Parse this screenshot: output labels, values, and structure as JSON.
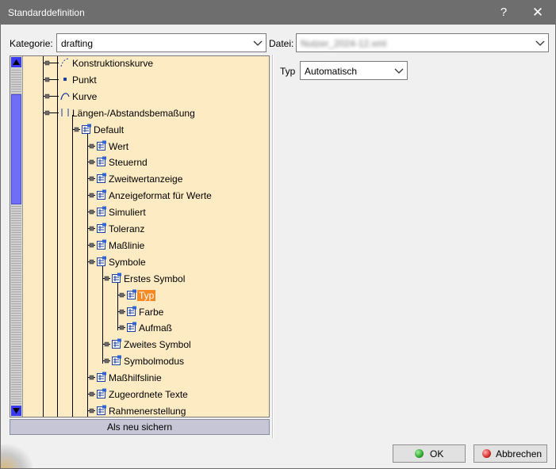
{
  "window": {
    "title": "Standarddefinition",
    "help": "?",
    "close": "✕"
  },
  "category": {
    "label": "Kategorie:",
    "value": "drafting"
  },
  "file": {
    "label": "Datei:",
    "value": "Nutzer_2024-12.xml"
  },
  "type_field": {
    "label": "Typ",
    "value": "Automatisch"
  },
  "tree": [
    {
      "label": "Konstruktionskurve",
      "icon": "construction-curve-icon",
      "level": 1
    },
    {
      "label": "Punkt",
      "icon": "point-icon",
      "level": 1
    },
    {
      "label": "Kurve",
      "icon": "curve-icon",
      "level": 1
    },
    {
      "label": "Längen-/Abstandsbemaßung",
      "icon": "dimension-icon",
      "level": 1
    },
    {
      "label": "Default",
      "icon": "parameter-icon",
      "level": 2
    },
    {
      "label": "Wert",
      "icon": "parameter-icon",
      "level": 3
    },
    {
      "label": "Steuernd",
      "icon": "parameter-icon",
      "level": 3
    },
    {
      "label": "Zweitwertanzeige",
      "icon": "parameter-icon",
      "level": 3
    },
    {
      "label": "Anzeigeformat für Werte",
      "icon": "parameter-icon",
      "level": 3
    },
    {
      "label": "Simuliert",
      "icon": "parameter-icon",
      "level": 3
    },
    {
      "label": "Toleranz",
      "icon": "parameter-icon",
      "level": 3
    },
    {
      "label": "Maßlinie",
      "icon": "parameter-icon",
      "level": 3
    },
    {
      "label": "Symbole",
      "icon": "parameter-icon",
      "level": 3
    },
    {
      "label": "Erstes Symbol",
      "icon": "parameter-icon",
      "level": 4
    },
    {
      "label": "Typ",
      "icon": "parameter-icon",
      "level": 5,
      "selected": true
    },
    {
      "label": "Farbe",
      "icon": "parameter-icon",
      "level": 5
    },
    {
      "label": "Aufmaß",
      "icon": "parameter-icon",
      "level": 5
    },
    {
      "label": "Zweites Symbol",
      "icon": "parameter-icon",
      "level": 4
    },
    {
      "label": "Symbolmodus",
      "icon": "parameter-icon",
      "level": 4
    },
    {
      "label": "Maßhilfslinie",
      "icon": "parameter-icon",
      "level": 3
    },
    {
      "label": "Zugeordnete Texte",
      "icon": "parameter-icon",
      "level": 3
    },
    {
      "label": "Rahmenerstellung",
      "icon": "parameter-icon",
      "level": 3
    }
  ],
  "save_as_new": "Als neu sichern",
  "ok": {
    "label": "OK",
    "color": "#2fa52f"
  },
  "cancel": {
    "label": "Abbrechen",
    "color": "#d42a2a"
  }
}
